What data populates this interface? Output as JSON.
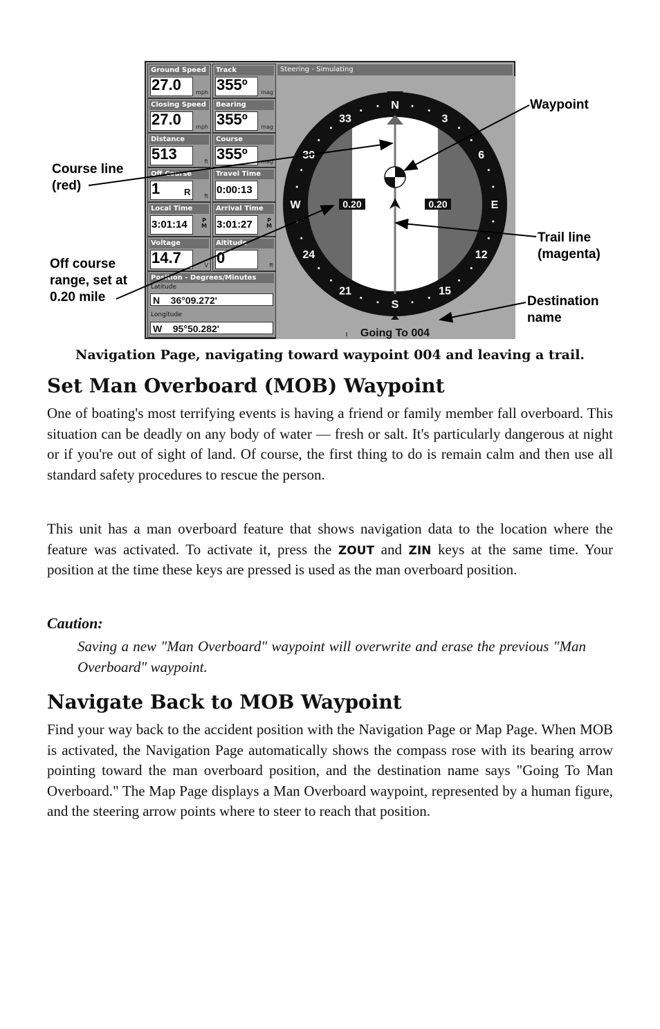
{
  "figure": {
    "panels": [
      {
        "label": "Ground Speed",
        "value": "27.0",
        "unit": "mph"
      },
      {
        "label": "Track",
        "value": "355º",
        "unit": "mag"
      },
      {
        "label": "Closing Speed",
        "value": "27.0",
        "unit": "mph"
      },
      {
        "label": "Bearing",
        "value": "355º",
        "unit": "mag"
      },
      {
        "label": "Distance",
        "value": "513",
        "unit": "ft"
      },
      {
        "label": "Course",
        "value": "355º",
        "unit": "mag"
      },
      {
        "label": "Off Course",
        "value": "1",
        "suffix": "R",
        "unit": "ft"
      },
      {
        "label": "Travel Time",
        "value": "0:00:13",
        "unit": ""
      },
      {
        "label": "Local Time",
        "value": "3:01:14",
        "ampm": "P M"
      },
      {
        "label": "Arrival Time",
        "value": "3:01:27",
        "ampm": "P M"
      },
      {
        "label": "Voltage",
        "value": "14.7",
        "unit": "V"
      },
      {
        "label": "Altitude",
        "value": "0",
        "unit": "ft"
      }
    ],
    "position": {
      "title": "Position - Degrees/Minutes",
      "latitude_label": "Latitude",
      "latitude_value": "N    36°09.272'",
      "longitude_label": "Longitude",
      "longitude_value": "W    95°50.282'"
    },
    "steering": {
      "title": "Steering - Simulating",
      "compass_labels": [
        "N",
        "3",
        "6",
        "E",
        "12",
        "15",
        "S",
        "21",
        "24",
        "W",
        "30",
        "33"
      ],
      "off_course_left": "0.20",
      "off_course_right": "0.20",
      "destination": "Going To 004"
    },
    "callouts": {
      "course_line": "Course line\n(red)",
      "off_course": "Off course\nrange, set at\n0.20 mile",
      "waypoint": "Waypoint",
      "trail_line": "Trail line\n(magenta)",
      "destination_name": "Destination\nname"
    },
    "caption": "Navigation Page, navigating toward waypoint 004 and leaving a trail."
  },
  "section1": {
    "heading": "Set Man Overboard (MOB) Waypoint",
    "para1": "One of boating's most terrifying events is having a friend or family member fall overboard. This situation can be deadly on any body of water — fresh or salt. It's particularly dangerous at night or if you're out of sight of land. Of course, the first thing to do is remain calm and then use all standard safety procedures to rescue the person.",
    "para2_a": "This unit has a man overboard feature that shows navigation data to the location where the feature was activated. To activate it, press the ",
    "key1": "ZOUT",
    "para2_b": " and ",
    "key2": "ZIN",
    "para2_c": " keys at the same time. Your position at the time these keys are pressed is used as the man overboard position.",
    "caution_title": "Caution:",
    "caution_text": "Saving a new \"Man Overboard\" waypoint will overwrite and erase the previous \"Man Overboard\" waypoint."
  },
  "section2": {
    "heading": "Navigate Back to MOB Waypoint",
    "para": "Find your way back to the accident position with the Navigation Page or Map Page. When MOB is activated, the Navigation Page automatically shows the compass rose with its bearing arrow pointing toward the man overboard position, and the destination name says \"Going To Man Overboard.\" The Map Page displays a Man Overboard waypoint, represented by a human figure, and the steering arrow points where to steer to reach that position."
  }
}
